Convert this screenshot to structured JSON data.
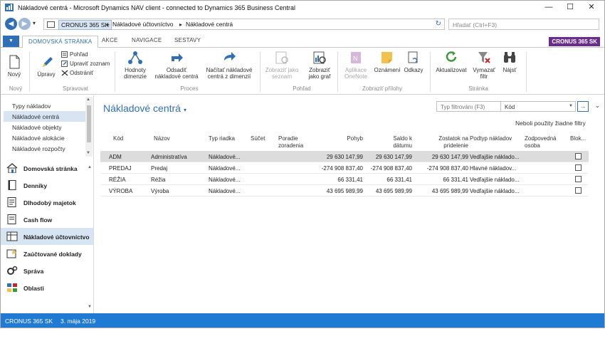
{
  "window": {
    "title": "Nákladové centrá - Microsoft Dynamics NAV client - connected to Dynamics 365 Business Central",
    "min_glyph": "—",
    "max_glyph": "☐",
    "close_glyph": "✕"
  },
  "addressbar": {
    "crumbs": [
      "CRONUS 365 SK",
      "Nákladové účtovníctvo",
      "Nákladové centrá"
    ],
    "search_placeholder": "Hľadať (Ctrl+F3)"
  },
  "tabs": [
    "DOMOVSKÁ STRÁNKA",
    "AKCE",
    "NAVIGACE",
    "SESTAVY"
  ],
  "company_badge": "CRONUS 365 SK",
  "ribbon": {
    "new": "Nový",
    "edit": "Úpravy",
    "view": "Pohľad",
    "edit_list": "Upraviť zoznam",
    "delete": "Odstrániť",
    "dimension_values_1": "Hodnoty",
    "dimension_values_2": "dimenzie",
    "send_cost_1": "Odsadiť",
    "send_cost_2": "nákladové centrá",
    "get_cost_1": "Načítať nákladové",
    "get_cost_2": "centrá z dimenzií",
    "show_list_1": "Zobraziť jako",
    "show_list_2": "seznam",
    "show_chart_1": "Zobraziť",
    "show_chart_2": "jako graf",
    "onenote_1": "Aplikace",
    "onenote_2": "OneNote",
    "notes": "Oznámení",
    "links": "Odkazy",
    "refresh": "Aktualizovat",
    "clear_filter_1": "Vymazať",
    "clear_filter_2": "filtr",
    "find": "Nájsť",
    "groups": [
      "Nový",
      "Spravovat",
      "Proces",
      "Pohľad",
      "Zobraziť přílohy",
      "Stránka"
    ]
  },
  "sidebar": {
    "items": [
      "Typy nákladov",
      "Nákladové centrá",
      "Nákladové objekty",
      "Nákladové alokácie",
      "Nákladové rozpočty"
    ],
    "nav": [
      {
        "label": "Domovská stránka",
        "icon": "home-icon"
      },
      {
        "label": "Denníky",
        "icon": "journal-icon"
      },
      {
        "label": "Dlhodobý majetok",
        "icon": "fixed-asset-icon"
      },
      {
        "label": "Cash flow",
        "icon": "cash-flow-icon"
      },
      {
        "label": "Nákladové účtovníctvo",
        "icon": "cost-accounting-icon"
      },
      {
        "label": "Zaúčtované doklady",
        "icon": "posted-documents-icon"
      },
      {
        "label": "Správa",
        "icon": "administration-icon"
      },
      {
        "label": "Oblasti",
        "icon": "areas-icon"
      }
    ]
  },
  "page": {
    "title": "Nákladové centrá",
    "filter_placeholder": "Typ filtrovánı (F3)",
    "filter_field": "Kód",
    "no_filters": "Neboli použity žiadne filtry"
  },
  "table": {
    "headers": {
      "code": "Kód",
      "name": "Názov",
      "line_type": "Typ riadka",
      "totaling": "Súčet",
      "sort_1": "Poradie",
      "sort_2": "zoradenia",
      "net_change": "Pohyb",
      "balance_1": "Saldo k",
      "balance_2": "dátumu",
      "remaining_1": "Zostatok na",
      "remaining_2": "pridelenie",
      "subtype": "Podtyp nákladov",
      "responsible_1": "Zodpovedná",
      "responsible_2": "osoba",
      "blocked": "Blok..."
    },
    "rows": [
      {
        "code": "ADM",
        "name": "Administratíva",
        "line_type": "Nákladové...",
        "net_change": "29 630 147,99",
        "balance": "29 630 147,99",
        "remaining": "29 630 147,99",
        "subtype": "Vedľajšie náklado..."
      },
      {
        "code": "PREDAJ",
        "name": "Predaj",
        "line_type": "Nákladové...",
        "net_change": "-274 908 837,40",
        "balance": "-274 908 837,40",
        "remaining": "-274 908 837,40",
        "subtype": "Hlavné nákladov..."
      },
      {
        "code": "RÉŽIA",
        "name": "Réžia",
        "line_type": "Nákladové...",
        "net_change": "66 331,41",
        "balance": "66 331,41",
        "remaining": "66 331,41",
        "subtype": "Vedľajšie náklado..."
      },
      {
        "code": "VÝROBA",
        "name": "Výroba",
        "line_type": "Nákladové...",
        "net_change": "43 695 989,99",
        "balance": "43 695 989,99",
        "remaining": "43 695 989,99",
        "subtype": "Vedľajšie náklado..."
      }
    ]
  },
  "statusbar": {
    "company": "CRONUS 365 SK",
    "date": "3. mája 2019"
  },
  "colors": {
    "accent": "#2e6fb7",
    "status": "#1f7ad4",
    "company_badge": "#6a2c91",
    "selection": "#d7e5f3"
  }
}
